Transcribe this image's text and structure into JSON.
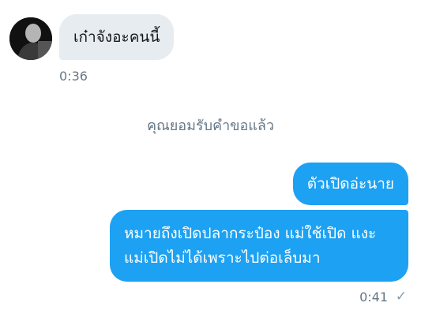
{
  "conversation": {
    "incoming": {
      "text": "เก๋าจังอะคนนี้",
      "time": "0:36"
    },
    "system_message": "คุณยอมรับคำขอแล้ว",
    "outgoing": [
      {
        "text": "ตัวเปิดอ่ะนาย"
      },
      {
        "text": "หมายถึงเปิดปลากระป๋อง แม่ใช้เปิด แงะ แม่เปิดไม่ได้เพราะไปต่อเล็บมา"
      }
    ],
    "outgoing_time": "0:41",
    "status_icon": "check-icon"
  },
  "colors": {
    "outgoing_bubble": "#1da1f2",
    "incoming_bubble": "#e6ecf0",
    "meta_text": "#657786"
  }
}
